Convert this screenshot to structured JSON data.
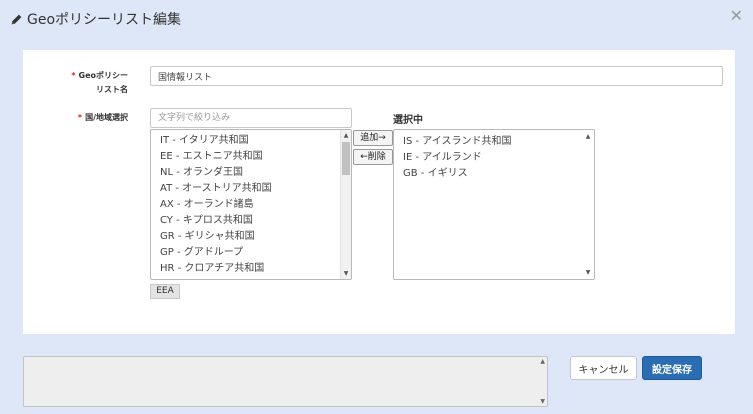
{
  "dialog": {
    "title": "Geoポリシーリスト編集",
    "close_glyph": "✕",
    "icon": "pencil-icon"
  },
  "form": {
    "required_mark": "*",
    "name_label_line1": "Geoポリシー",
    "name_label_line2": "リスト名",
    "name_value": "国情報リスト",
    "country_label": "国/地域選択",
    "filter_placeholder": "文字列で絞り込み"
  },
  "available_list": {
    "items": [
      "IT - イタリア共和国",
      "EE - エストニア共和国",
      "NL - オランダ王国",
      "AT - オーストリア共和国",
      "AX - オーランド諸島",
      "CY - キプロス共和国",
      "GR - ギリシャ共和国",
      "GP - グアドループ",
      "HR - クロアチア共和国"
    ]
  },
  "move_buttons": {
    "add": "追加→",
    "remove": "←削除"
  },
  "selected": {
    "title": "選択中",
    "items": [
      "IS - アイスランド共和国",
      "IE - アイルランド",
      "GB - イギリス"
    ]
  },
  "group_tag": "EEA",
  "footer": {
    "cancel": "キャンセル",
    "save": "設定保存"
  },
  "colors": {
    "background": "#dde7f7",
    "primary": "#2a6db3",
    "required": "#e2231a"
  }
}
